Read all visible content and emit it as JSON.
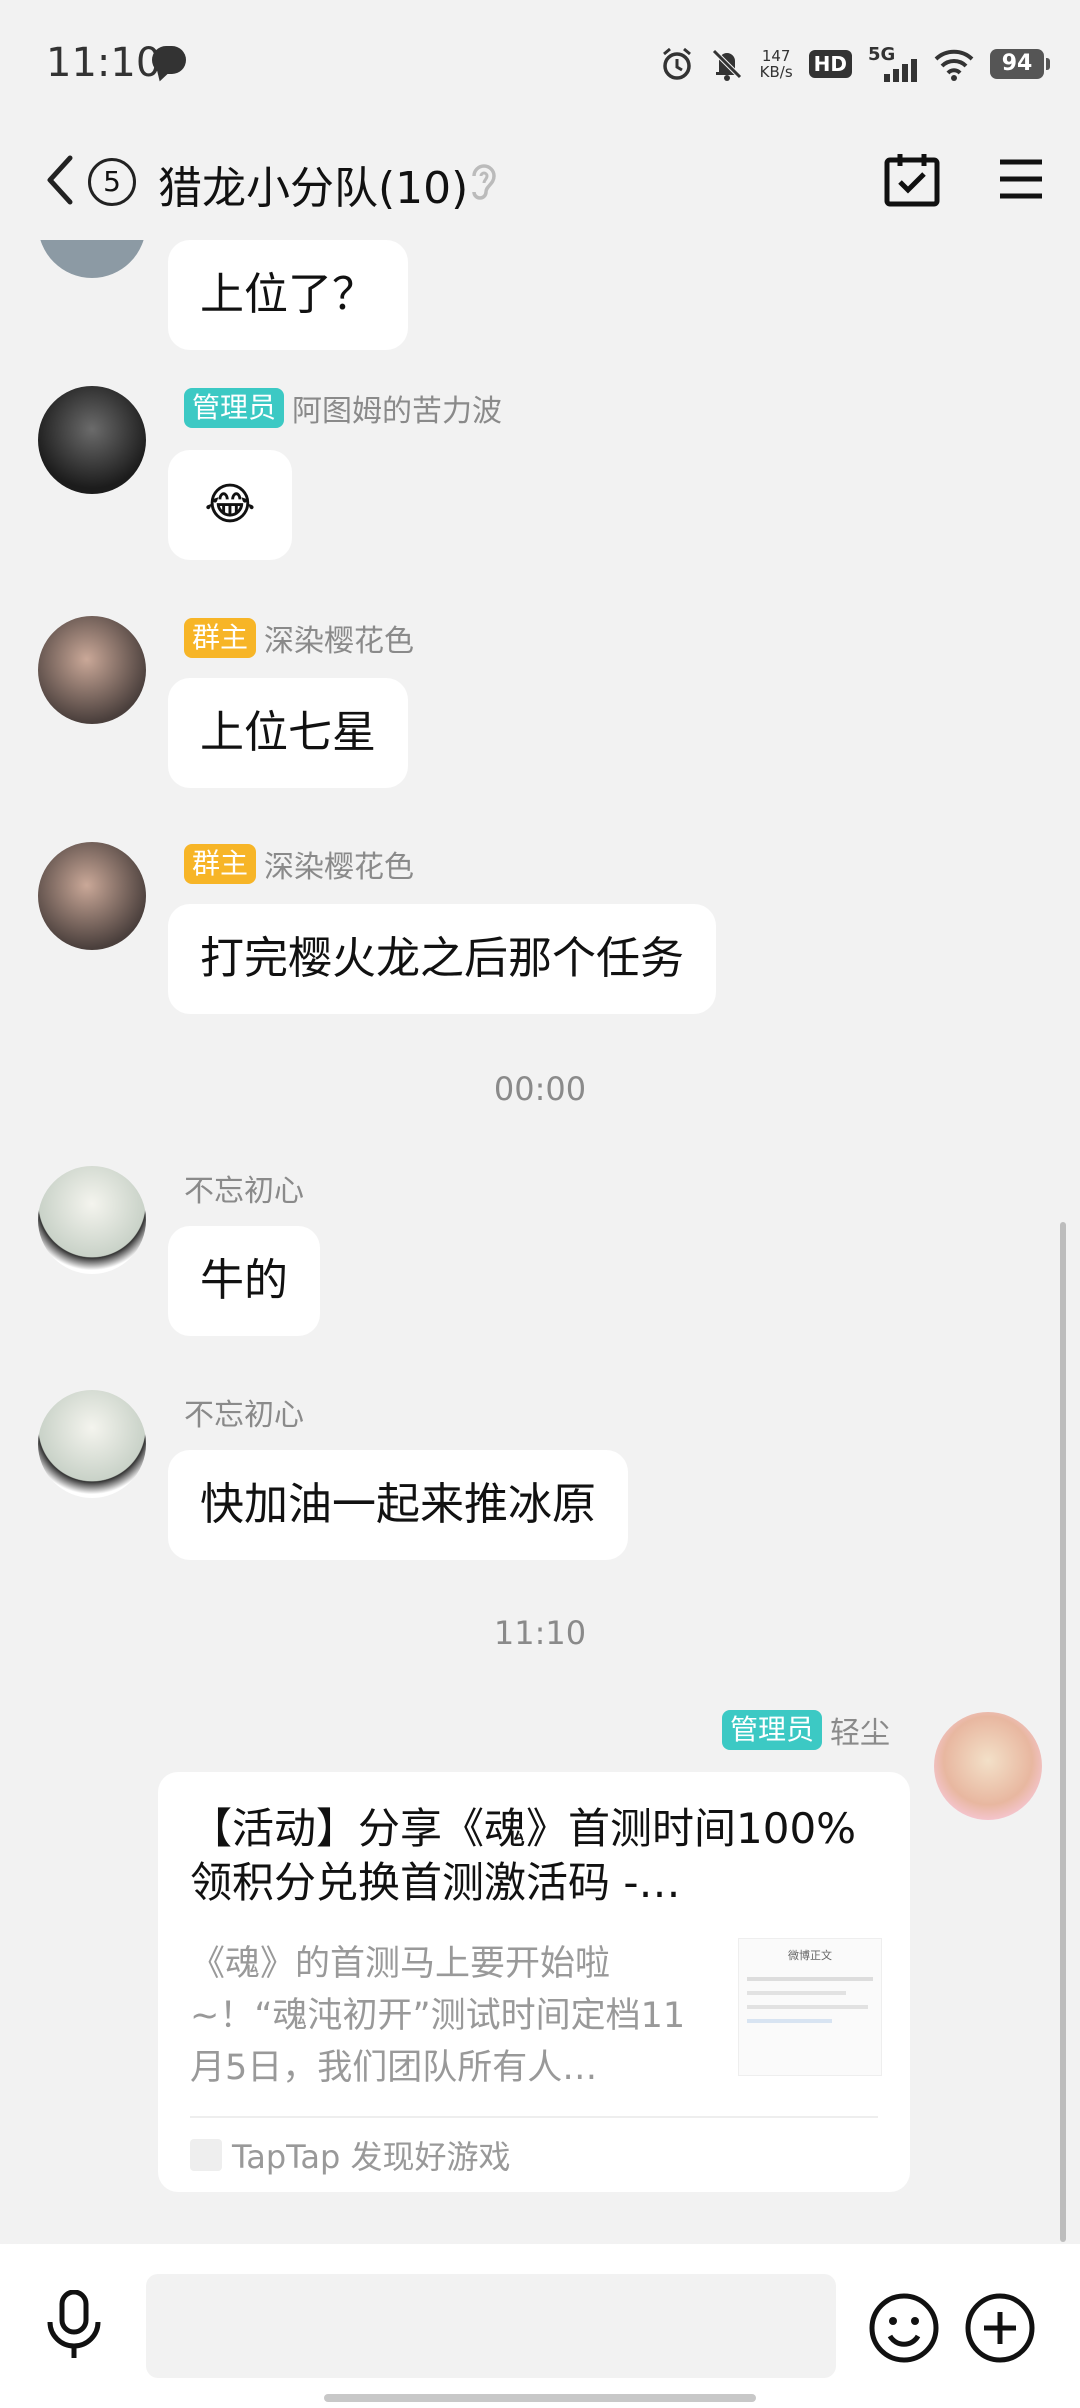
{
  "status_bar": {
    "time": "11:10",
    "speed_value": "147",
    "speed_unit": "KB/s",
    "hd": "HD",
    "network": "5G",
    "battery": "94"
  },
  "header": {
    "unread_count": "5",
    "title": "猎龙小分队(10)"
  },
  "messages": [
    {
      "text": "上位了？"
    },
    {
      "role": "管理员",
      "name": "阿图姆的苦力波",
      "text": "😂"
    },
    {
      "role": "群主",
      "name": "深染樱花色",
      "text": "上位七星"
    },
    {
      "role": "群主",
      "name": "深染樱花色",
      "text": "打完樱火龙之后那个任务"
    },
    {
      "name": "不忘初心",
      "text": "牛的"
    },
    {
      "name": "不忘初心",
      "text": "快加油一起来推冰原"
    }
  ],
  "timestamps": [
    "00:00",
    "11:10"
  ],
  "card_message": {
    "role": "管理员",
    "name": "轻尘",
    "title": "【活动】分享《魂》首测时间100%领积分兑换首测激活码 -…",
    "description": "《魂》的首测马上要开始啦~！“魂沌初开”测试时间定档11月5日，我们团队所有人…",
    "source": "TapTap 发现好游戏",
    "thumb_text": "微博正文"
  },
  "colors": {
    "admin_badge": "#3cc9c4",
    "owner_badge": "#f7b527",
    "background": "#f2f2f2"
  }
}
